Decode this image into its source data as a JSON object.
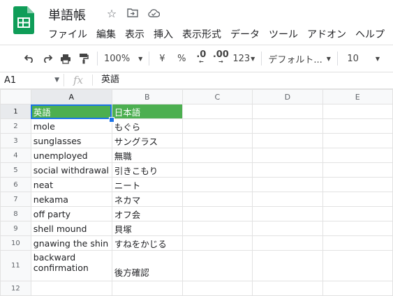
{
  "app": {
    "title": "単語帳",
    "menus": [
      "ファイル",
      "編集",
      "表示",
      "挿入",
      "表示形式",
      "データ",
      "ツール",
      "アドオン",
      "ヘルプ"
    ]
  },
  "toolbar": {
    "zoom": "100%",
    "currency": "¥",
    "percent": "%",
    "dec_decrease": ".0",
    "dec_increase": ".00",
    "more_formats": "123",
    "font": "デフォルト...",
    "font_size": "10"
  },
  "formula": {
    "cell_ref": "A1",
    "fx": "fx",
    "value": "英語"
  },
  "sheet": {
    "columns": [
      "A",
      "B",
      "C",
      "D",
      "E"
    ],
    "header": {
      "row": "1",
      "a": "英語",
      "b": "日本語"
    },
    "rows": [
      {
        "row": "2",
        "a": "mole",
        "b": "もぐら"
      },
      {
        "row": "3",
        "a": "sunglasses",
        "b": "サングラス"
      },
      {
        "row": "4",
        "a": "unemployed",
        "b": "無職"
      },
      {
        "row": "5",
        "a": "social withdrawal",
        "b": "引きこもり"
      },
      {
        "row": "6",
        "a": "neat",
        "b": "ニート"
      },
      {
        "row": "7",
        "a": "nekama",
        "b": "ネカマ"
      },
      {
        "row": "8",
        "a": "off party",
        "b": "オフ会"
      },
      {
        "row": "9",
        "a": "shell mound",
        "b": "貝塚"
      },
      {
        "row": "10",
        "a": "gnawing the shin",
        "b": "すねをかじる"
      }
    ],
    "row11": {
      "row": "11",
      "a": "backward confirmation",
      "b": "後方確認"
    },
    "row12": {
      "row": "12"
    }
  },
  "colors": {
    "header_fill": "#4caf50",
    "selection": "#1a73e8",
    "logo": "#0f9d58"
  }
}
